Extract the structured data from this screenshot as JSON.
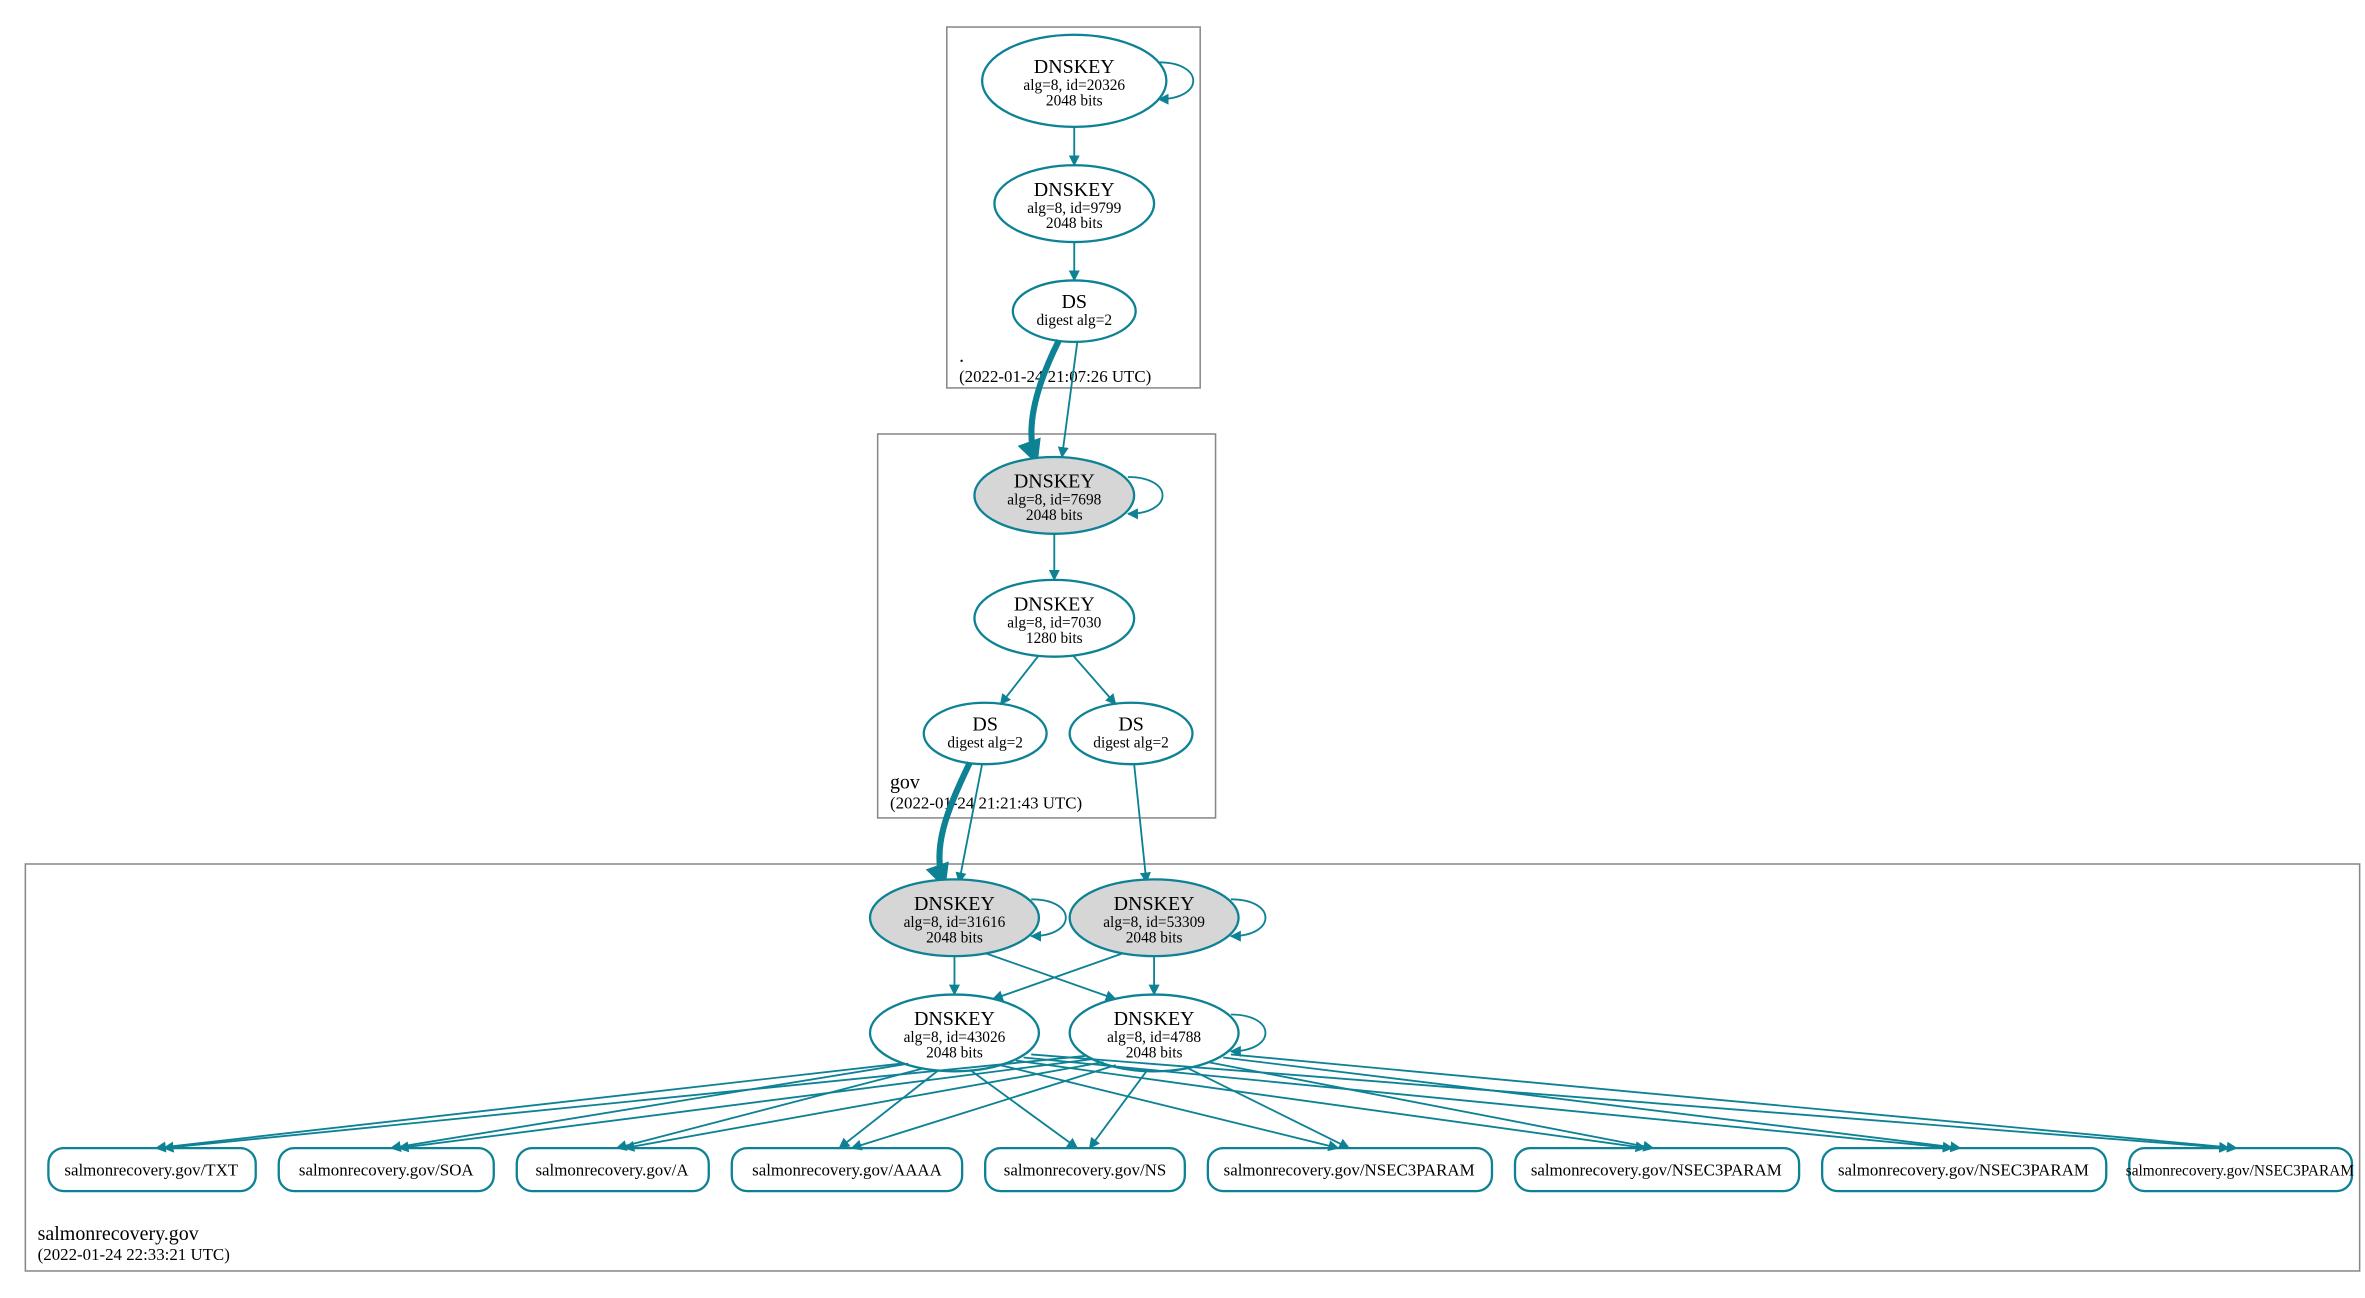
{
  "zones": {
    "root": {
      "label": ".",
      "time": "(2022-01-24 21:07:26 UTC)"
    },
    "gov": {
      "label": "gov",
      "time": "(2022-01-24 21:21:43 UTC)"
    },
    "salmon": {
      "label": "salmonrecovery.gov",
      "time": "(2022-01-24 22:33:21 UTC)"
    }
  },
  "nodes": {
    "root_ksk": {
      "title": "DNSKEY",
      "l2": "alg=8, id=20326",
      "l3": "2048 bits"
    },
    "root_zsk": {
      "title": "DNSKEY",
      "l2": "alg=8, id=9799",
      "l3": "2048 bits"
    },
    "root_ds": {
      "title": "DS",
      "l2": "digest alg=2"
    },
    "gov_ksk": {
      "title": "DNSKEY",
      "l2": "alg=8, id=7698",
      "l3": "2048 bits"
    },
    "gov_zsk": {
      "title": "DNSKEY",
      "l2": "alg=8, id=7030",
      "l3": "1280 bits"
    },
    "gov_ds1": {
      "title": "DS",
      "l2": "digest alg=2"
    },
    "gov_ds2": {
      "title": "DS",
      "l2": "digest alg=2"
    },
    "sal_ksk1": {
      "title": "DNSKEY",
      "l2": "alg=8, id=31616",
      "l3": "2048 bits"
    },
    "sal_ksk2": {
      "title": "DNSKEY",
      "l2": "alg=8, id=53309",
      "l3": "2048 bits"
    },
    "sal_zsk1": {
      "title": "DNSKEY",
      "l2": "alg=8, id=43026",
      "l3": "2048 bits"
    },
    "sal_zsk2": {
      "title": "DNSKEY",
      "l2": "alg=8, id=4788",
      "l3": "2048 bits"
    }
  },
  "rr": {
    "txt": "salmonrecovery.gov/TXT",
    "soa": "salmonrecovery.gov/SOA",
    "a": "salmonrecovery.gov/A",
    "aaaa": "salmonrecovery.gov/AAAA",
    "ns": "salmonrecovery.gov/NS",
    "n1": "salmonrecovery.gov/NSEC3PARAM",
    "n2": "salmonrecovery.gov/NSEC3PARAM",
    "n3": "salmonrecovery.gov/NSEC3PARAM",
    "n4": "salmonrecovery.gov/NSEC3PARAM"
  }
}
